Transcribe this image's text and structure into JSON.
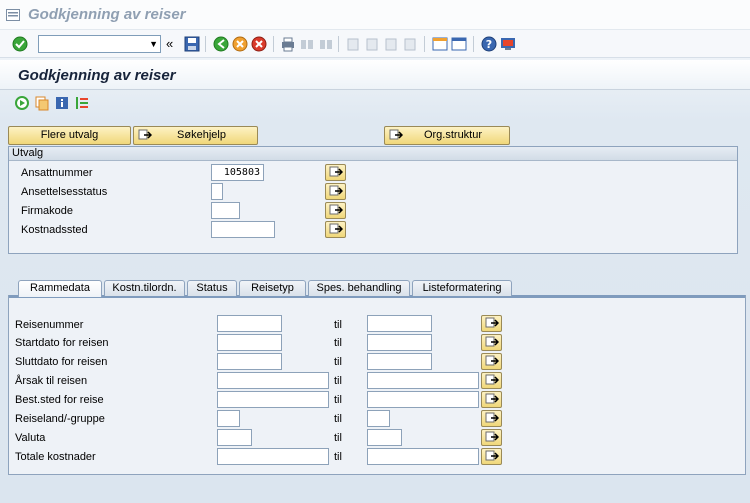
{
  "window": {
    "title": "Godkjenning av reiser"
  },
  "system_toolbar": {
    "command_value": "",
    "prev_label": "«"
  },
  "app": {
    "title": "Godkjenning av reiser"
  },
  "buttons": {
    "more_selections": "Flere utvalg",
    "search_help": "Søkehjelp",
    "org_structure": "Org.struktur"
  },
  "selection": {
    "header": "Utvalg",
    "rows": [
      {
        "label": "Ansattnummer",
        "value": "105803"
      },
      {
        "label": "Ansettelsesstatus",
        "value": ""
      },
      {
        "label": "Firmakode",
        "value": ""
      },
      {
        "label": "Kostnadssted",
        "value": ""
      }
    ]
  },
  "tabs": [
    {
      "label": "Rammedata",
      "active": true
    },
    {
      "label": "Kostn.tilordn."
    },
    {
      "label": "Status"
    },
    {
      "label": "Reisetyp"
    },
    {
      "label": "Spes. behandling"
    },
    {
      "label": "Listeformatering"
    }
  ],
  "rammedata": {
    "to_label": "til",
    "rows": [
      {
        "label": "Reisenummer",
        "from": "",
        "to": ""
      },
      {
        "label": "Startdato for reisen",
        "from": "",
        "to": ""
      },
      {
        "label": "Sluttdato for reisen",
        "from": "",
        "to": ""
      },
      {
        "label": "Årsak til reisen",
        "from": "",
        "to": ""
      },
      {
        "label": "Best.sted for reise",
        "from": "",
        "to": ""
      },
      {
        "label": "Reiseland/-gruppe",
        "from": "",
        "to": ""
      },
      {
        "label": "Valuta",
        "from": "",
        "to": ""
      },
      {
        "label": "Totale kostnader",
        "from": "",
        "to": ""
      }
    ]
  }
}
